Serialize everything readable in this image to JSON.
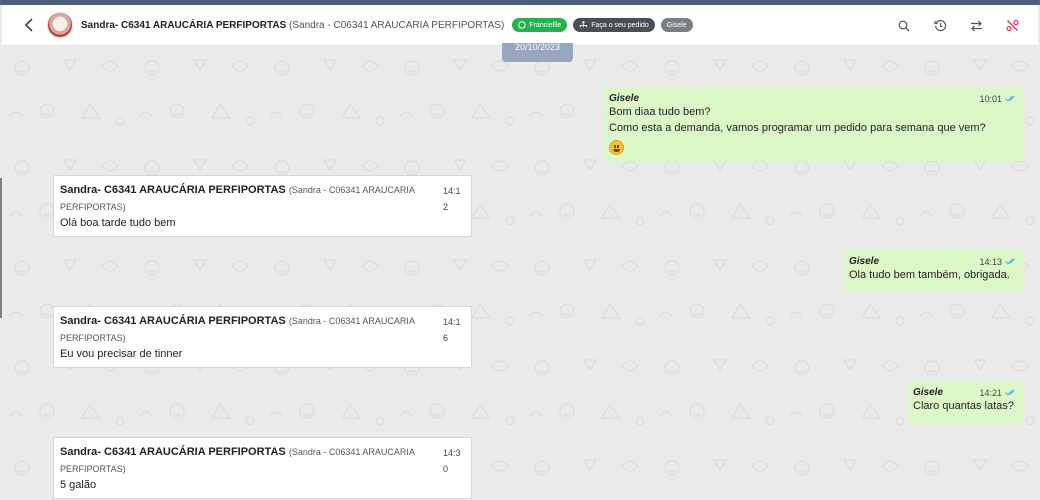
{
  "header": {
    "contact_name": "Sandra- C6341 ARAUCÁRIA PERFIPORTAS",
    "contact_sub": "(Sandra - C06341 ARAUCARIA PERFIPORTAS)",
    "badges": [
      "Franciellle",
      "Faça o seu pedido",
      "Gisele"
    ],
    "icons": [
      "search-icon",
      "history-icon",
      "transfer-icon",
      "percent-icon"
    ]
  },
  "date_chip": "20/10/2023",
  "colors": {
    "outgoing": "#dcf8c6",
    "incoming": "#ffffff",
    "background": "#ebebeb",
    "whatsapp_badge": "#24b34b",
    "close_icon": "#e6345a",
    "read_ticks": "#4fb6ec"
  },
  "messages": [
    {
      "direction": "out",
      "sender": "Gisele",
      "time": "10:01",
      "lines": [
        "Bom diaa tudo bem?",
        "Como esta a demanda, vamos programar um pedido para semana que vem?"
      ],
      "emoji": "grinning-face"
    },
    {
      "direction": "in",
      "name": "Sandra- C6341 ARAUCÁRIA PERFIPORTAS",
      "sub": "(Sandra - C06341 ARAUCARIA PERFIPORTAS)",
      "time": "14:12",
      "text": "Olá boa tarde tudo bem"
    },
    {
      "direction": "out",
      "sender": "Gisele",
      "time": "14:13",
      "lines": [
        "Ola tudo bem também, obrigada."
      ]
    },
    {
      "direction": "in",
      "name": "Sandra- C6341 ARAUCÁRIA PERFIPORTAS",
      "sub": "(Sandra - C06341 ARAUCARIA PERFIPORTAS)",
      "time": "14:16",
      "text": "Eu vou precisar de tinner"
    },
    {
      "direction": "out",
      "sender": "Gisele",
      "time": "14:21",
      "lines": [
        "Claro quantas latas?"
      ]
    },
    {
      "direction": "in",
      "name": "Sandra- C6341 ARAUCÁRIA PERFIPORTAS",
      "sub": "(Sandra - C06341 ARAUCARIA PERFIPORTAS)",
      "time": "14:30",
      "text": "5 galão"
    }
  ]
}
